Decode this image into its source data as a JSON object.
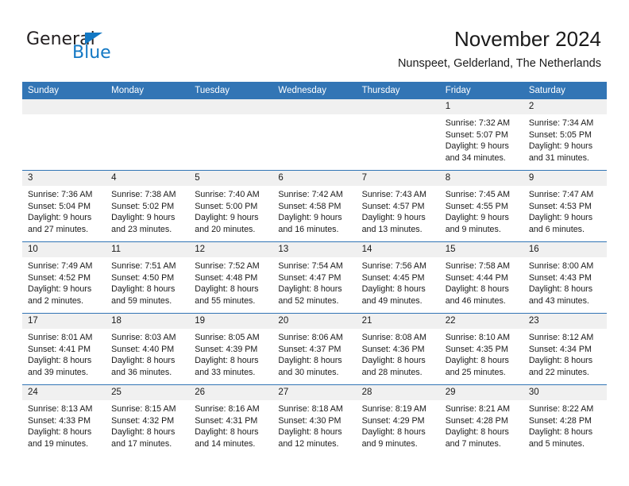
{
  "brand": {
    "name_part1": "General",
    "name_part2": "Blue",
    "triangle_color": "#1378c4"
  },
  "header": {
    "title": "November 2024",
    "subtitle": "Nunspeet, Gelderland, The Netherlands"
  },
  "theme": {
    "header_blue": "#3275b5",
    "daynum_band_gray": "#f0f0f0",
    "text": "#1a1a1a"
  },
  "weekday_headers": [
    "Sunday",
    "Monday",
    "Tuesday",
    "Wednesday",
    "Thursday",
    "Friday",
    "Saturday"
  ],
  "weeks": [
    [
      {
        "day": "",
        "sunrise": "",
        "sunset": "",
        "daylight_line1": "",
        "daylight_line2": "",
        "empty": true
      },
      {
        "day": "",
        "sunrise": "",
        "sunset": "",
        "daylight_line1": "",
        "daylight_line2": "",
        "empty": true
      },
      {
        "day": "",
        "sunrise": "",
        "sunset": "",
        "daylight_line1": "",
        "daylight_line2": "",
        "empty": true
      },
      {
        "day": "",
        "sunrise": "",
        "sunset": "",
        "daylight_line1": "",
        "daylight_line2": "",
        "empty": true
      },
      {
        "day": "",
        "sunrise": "",
        "sunset": "",
        "daylight_line1": "",
        "daylight_line2": "",
        "empty": true
      },
      {
        "day": "1",
        "sunrise": "Sunrise: 7:32 AM",
        "sunset": "Sunset: 5:07 PM",
        "daylight_line1": "Daylight: 9 hours",
        "daylight_line2": "and 34 minutes."
      },
      {
        "day": "2",
        "sunrise": "Sunrise: 7:34 AM",
        "sunset": "Sunset: 5:05 PM",
        "daylight_line1": "Daylight: 9 hours",
        "daylight_line2": "and 31 minutes."
      }
    ],
    [
      {
        "day": "3",
        "sunrise": "Sunrise: 7:36 AM",
        "sunset": "Sunset: 5:04 PM",
        "daylight_line1": "Daylight: 9 hours",
        "daylight_line2": "and 27 minutes."
      },
      {
        "day": "4",
        "sunrise": "Sunrise: 7:38 AM",
        "sunset": "Sunset: 5:02 PM",
        "daylight_line1": "Daylight: 9 hours",
        "daylight_line2": "and 23 minutes."
      },
      {
        "day": "5",
        "sunrise": "Sunrise: 7:40 AM",
        "sunset": "Sunset: 5:00 PM",
        "daylight_line1": "Daylight: 9 hours",
        "daylight_line2": "and 20 minutes."
      },
      {
        "day": "6",
        "sunrise": "Sunrise: 7:42 AM",
        "sunset": "Sunset: 4:58 PM",
        "daylight_line1": "Daylight: 9 hours",
        "daylight_line2": "and 16 minutes."
      },
      {
        "day": "7",
        "sunrise": "Sunrise: 7:43 AM",
        "sunset": "Sunset: 4:57 PM",
        "daylight_line1": "Daylight: 9 hours",
        "daylight_line2": "and 13 minutes."
      },
      {
        "day": "8",
        "sunrise": "Sunrise: 7:45 AM",
        "sunset": "Sunset: 4:55 PM",
        "daylight_line1": "Daylight: 9 hours",
        "daylight_line2": "and 9 minutes."
      },
      {
        "day": "9",
        "sunrise": "Sunrise: 7:47 AM",
        "sunset": "Sunset: 4:53 PM",
        "daylight_line1": "Daylight: 9 hours",
        "daylight_line2": "and 6 minutes."
      }
    ],
    [
      {
        "day": "10",
        "sunrise": "Sunrise: 7:49 AM",
        "sunset": "Sunset: 4:52 PM",
        "daylight_line1": "Daylight: 9 hours",
        "daylight_line2": "and 2 minutes."
      },
      {
        "day": "11",
        "sunrise": "Sunrise: 7:51 AM",
        "sunset": "Sunset: 4:50 PM",
        "daylight_line1": "Daylight: 8 hours",
        "daylight_line2": "and 59 minutes."
      },
      {
        "day": "12",
        "sunrise": "Sunrise: 7:52 AM",
        "sunset": "Sunset: 4:48 PM",
        "daylight_line1": "Daylight: 8 hours",
        "daylight_line2": "and 55 minutes."
      },
      {
        "day": "13",
        "sunrise": "Sunrise: 7:54 AM",
        "sunset": "Sunset: 4:47 PM",
        "daylight_line1": "Daylight: 8 hours",
        "daylight_line2": "and 52 minutes."
      },
      {
        "day": "14",
        "sunrise": "Sunrise: 7:56 AM",
        "sunset": "Sunset: 4:45 PM",
        "daylight_line1": "Daylight: 8 hours",
        "daylight_line2": "and 49 minutes."
      },
      {
        "day": "15",
        "sunrise": "Sunrise: 7:58 AM",
        "sunset": "Sunset: 4:44 PM",
        "daylight_line1": "Daylight: 8 hours",
        "daylight_line2": "and 46 minutes."
      },
      {
        "day": "16",
        "sunrise": "Sunrise: 8:00 AM",
        "sunset": "Sunset: 4:43 PM",
        "daylight_line1": "Daylight: 8 hours",
        "daylight_line2": "and 43 minutes."
      }
    ],
    [
      {
        "day": "17",
        "sunrise": "Sunrise: 8:01 AM",
        "sunset": "Sunset: 4:41 PM",
        "daylight_line1": "Daylight: 8 hours",
        "daylight_line2": "and 39 minutes."
      },
      {
        "day": "18",
        "sunrise": "Sunrise: 8:03 AM",
        "sunset": "Sunset: 4:40 PM",
        "daylight_line1": "Daylight: 8 hours",
        "daylight_line2": "and 36 minutes."
      },
      {
        "day": "19",
        "sunrise": "Sunrise: 8:05 AM",
        "sunset": "Sunset: 4:39 PM",
        "daylight_line1": "Daylight: 8 hours",
        "daylight_line2": "and 33 minutes."
      },
      {
        "day": "20",
        "sunrise": "Sunrise: 8:06 AM",
        "sunset": "Sunset: 4:37 PM",
        "daylight_line1": "Daylight: 8 hours",
        "daylight_line2": "and 30 minutes."
      },
      {
        "day": "21",
        "sunrise": "Sunrise: 8:08 AM",
        "sunset": "Sunset: 4:36 PM",
        "daylight_line1": "Daylight: 8 hours",
        "daylight_line2": "and 28 minutes."
      },
      {
        "day": "22",
        "sunrise": "Sunrise: 8:10 AM",
        "sunset": "Sunset: 4:35 PM",
        "daylight_line1": "Daylight: 8 hours",
        "daylight_line2": "and 25 minutes."
      },
      {
        "day": "23",
        "sunrise": "Sunrise: 8:12 AM",
        "sunset": "Sunset: 4:34 PM",
        "daylight_line1": "Daylight: 8 hours",
        "daylight_line2": "and 22 minutes."
      }
    ],
    [
      {
        "day": "24",
        "sunrise": "Sunrise: 8:13 AM",
        "sunset": "Sunset: 4:33 PM",
        "daylight_line1": "Daylight: 8 hours",
        "daylight_line2": "and 19 minutes."
      },
      {
        "day": "25",
        "sunrise": "Sunrise: 8:15 AM",
        "sunset": "Sunset: 4:32 PM",
        "daylight_line1": "Daylight: 8 hours",
        "daylight_line2": "and 17 minutes."
      },
      {
        "day": "26",
        "sunrise": "Sunrise: 8:16 AM",
        "sunset": "Sunset: 4:31 PM",
        "daylight_line1": "Daylight: 8 hours",
        "daylight_line2": "and 14 minutes."
      },
      {
        "day": "27",
        "sunrise": "Sunrise: 8:18 AM",
        "sunset": "Sunset: 4:30 PM",
        "daylight_line1": "Daylight: 8 hours",
        "daylight_line2": "and 12 minutes."
      },
      {
        "day": "28",
        "sunrise": "Sunrise: 8:19 AM",
        "sunset": "Sunset: 4:29 PM",
        "daylight_line1": "Daylight: 8 hours",
        "daylight_line2": "and 9 minutes."
      },
      {
        "day": "29",
        "sunrise": "Sunrise: 8:21 AM",
        "sunset": "Sunset: 4:28 PM",
        "daylight_line1": "Daylight: 8 hours",
        "daylight_line2": "and 7 minutes."
      },
      {
        "day": "30",
        "sunrise": "Sunrise: 8:22 AM",
        "sunset": "Sunset: 4:28 PM",
        "daylight_line1": "Daylight: 8 hours",
        "daylight_line2": "and 5 minutes."
      }
    ]
  ]
}
